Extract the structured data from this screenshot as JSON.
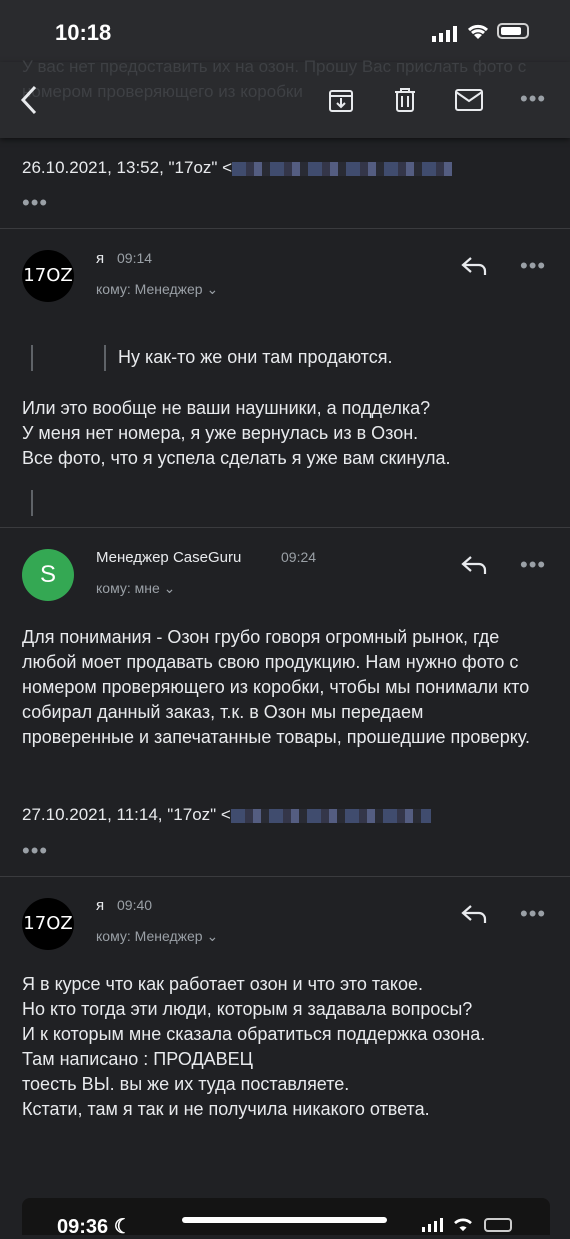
{
  "status_bar": {
    "time": "10:18"
  },
  "toolbar": {
    "ghost_text": "У вас нет предоставить их на озон. Прошу Вас прислать фото с номером проверяющего из коробки"
  },
  "quoted_header": {
    "text": "26.10.2021, 13:52, \"17oz\" <"
  },
  "messages": [
    {
      "avatar": "17OZ",
      "sender": "я",
      "time": "09:14",
      "to": "кому: Менеджер",
      "quote": "Ну как-то же они там продаются.",
      "body": "Или это вообще не ваши наушники, а подделка?\nУ меня нет номера, я уже вернулась из в Озон.\nВсе фото, что я успела сделать я уже вам скинула."
    },
    {
      "avatar": "S",
      "sender": "Менеджер CaseGuru",
      "time": "09:24",
      "to": "кому: мне",
      "body": "Для понимания - Озон грубо говоря огромный рынок, где любой моет продавать свою продукцию. Нам нужно фото с номером проверяющего из коробки, чтобы мы понимали кто собирал данный заказ, т.к. в Озон мы передаем проверенные и запечатанные товары, прошедшие проверку.",
      "quoted_header": "27.10.2021, 11:14, \"17oz\" <"
    },
    {
      "avatar": "17OZ",
      "sender": "я",
      "time": "09:40",
      "to": "кому: Менеджер",
      "body": "Я в курсе что как работает озон и что это такое.\nНо кто тогда эти люди, которым я задавала вопросы?\nИ к которым мне сказала обратиться поддержка озона.\nТам написано : ПРОДАВЕЦ\nтоесть ВЫ. вы же их туда поставляете.\nКстати, там я так и не получила никакого ответа."
    }
  ],
  "more_label": "•••",
  "bottom_status": {
    "time": "09:36"
  },
  "colors": {
    "background": "#202124",
    "accent_green": "#34a853",
    "text": "#e8eaed"
  }
}
